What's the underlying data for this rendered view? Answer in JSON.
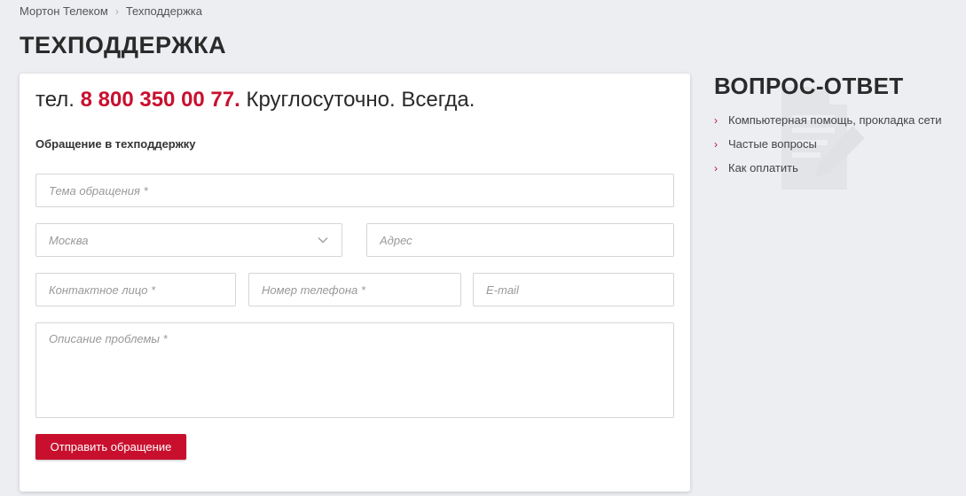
{
  "breadcrumb": {
    "items": [
      "Мортон Телеком",
      "Техподдержка"
    ],
    "separator": "›"
  },
  "page": {
    "title": "ТЕХПОДДЕРЖКА"
  },
  "contact": {
    "prefix": "тел. ",
    "phone": "8 800 350 00 77.",
    "suffix": " Круглосуточно. Всегда."
  },
  "form": {
    "heading": "Обращение в техподдержку",
    "subject_placeholder": "Тема обращения *",
    "city_value": "Москва",
    "address_placeholder": "Адрес",
    "contact_placeholder": "Контактное лицо *",
    "phone_placeholder": "Номер телефона *",
    "email_placeholder": "E-mail",
    "description_placeholder": "Описание проблемы *",
    "submit_label": "Отправить обращение"
  },
  "faq": {
    "title": "ВОПРОС-ОТВЕТ",
    "bullet": "›",
    "items": [
      "Компьютерная помощь, прокладка сети",
      "Частые вопросы",
      "Как оплатить"
    ]
  },
  "colors": {
    "accent": "#c8102e",
    "background": "#eceef2",
    "card": "#ffffff"
  },
  "icons": {
    "city_dropdown": "chevron-down-icon",
    "faq_background": "document-edit-icon"
  }
}
